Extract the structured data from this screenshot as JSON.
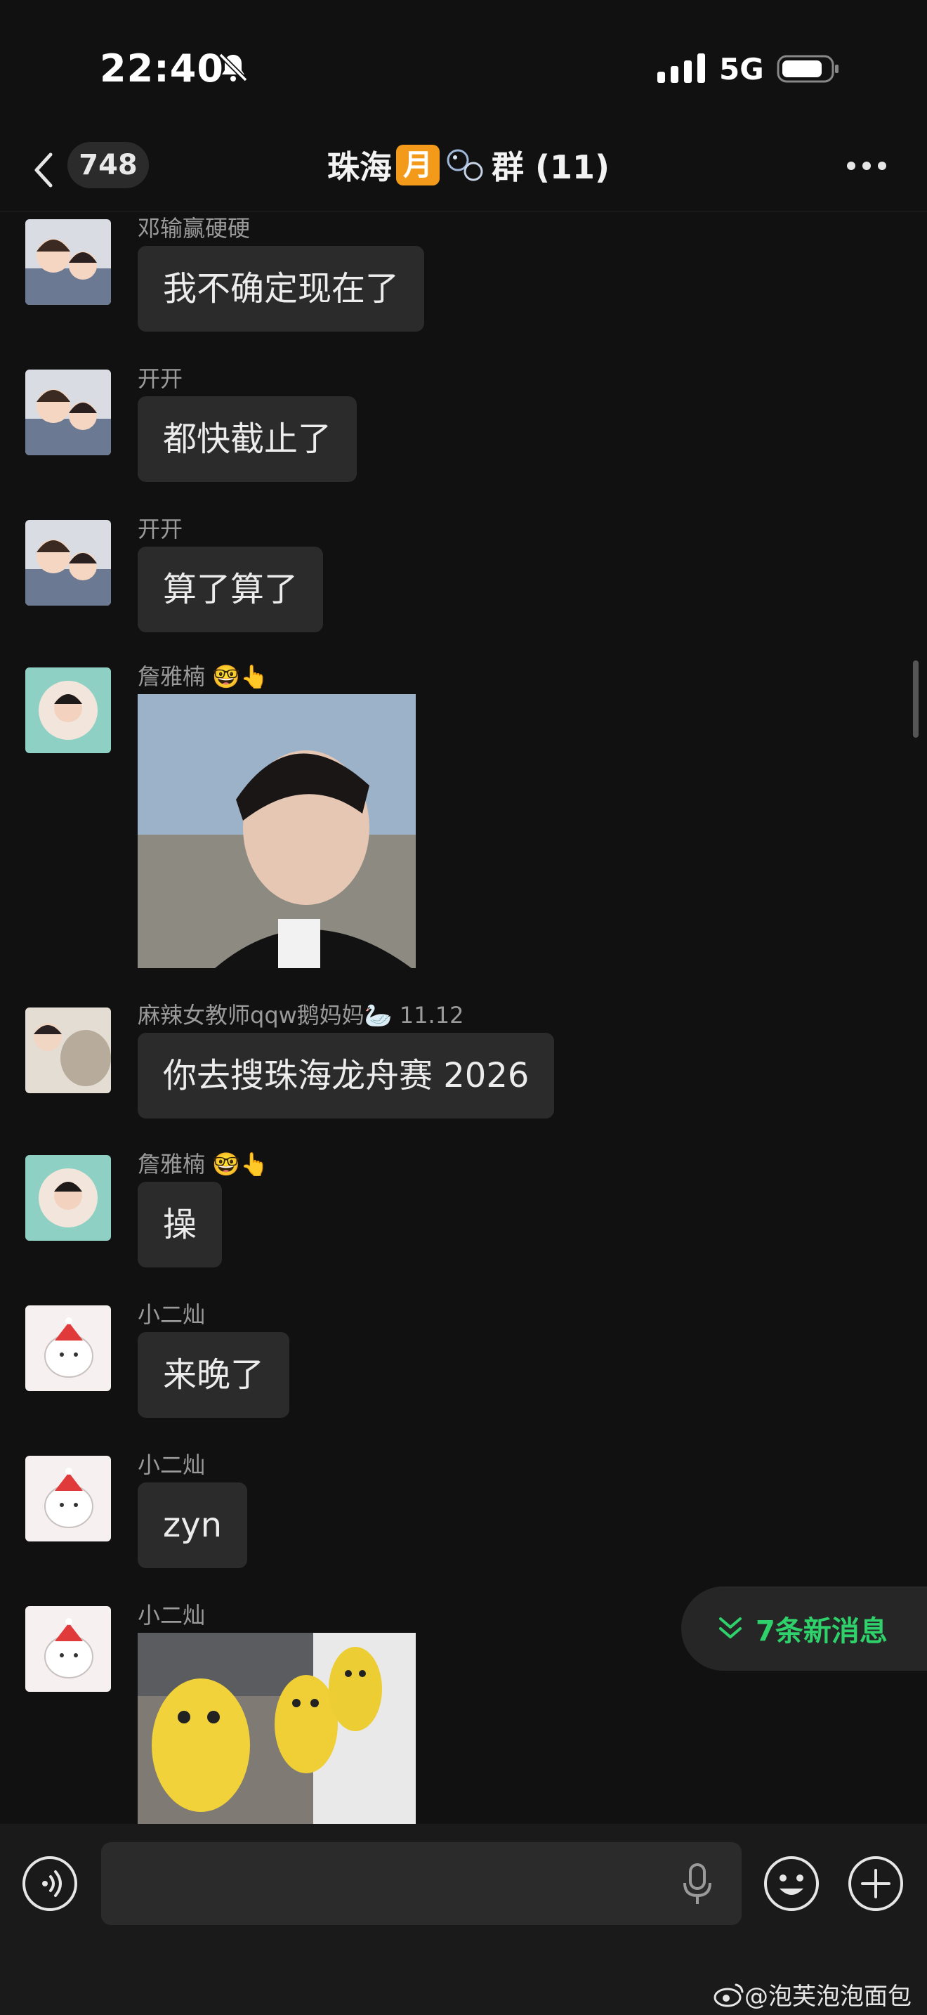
{
  "status_bar": {
    "time": "22:40",
    "network": "5G",
    "icons": [
      "bell-slash-icon",
      "signal-icon",
      "battery-icon"
    ]
  },
  "header": {
    "back_count": "748",
    "title_prefix": "珠海",
    "title_badge": "月",
    "title_suffix": "群 (11)",
    "icons": [
      "back-chevron-icon",
      "moon-badge-icon",
      "bubbles-icon",
      "more-icon"
    ]
  },
  "messages": [
    {
      "sender": "邓输赢硬硬",
      "text": "我不确定现在了"
    },
    {
      "sender": "开开",
      "text": "都快截止了"
    },
    {
      "sender": "开开",
      "text": "算了算了"
    },
    {
      "sender": "詹雅楠",
      "type": "image"
    },
    {
      "sender": "麻辣女教师qqw鹅妈妈",
      "sender_extra": "11.12",
      "text": "你去搜珠海龙舟赛 2026"
    },
    {
      "sender": "詹雅楠",
      "text": "操"
    },
    {
      "sender": "小二灿",
      "text": "来晚了"
    },
    {
      "sender": "小二灿",
      "text": "zyn"
    },
    {
      "sender": "小二灿",
      "type": "image"
    }
  ],
  "new_messages_label": "7条新消息",
  "accent_color": "#2fd16b",
  "watermark": "@泡芙泡泡面包"
}
